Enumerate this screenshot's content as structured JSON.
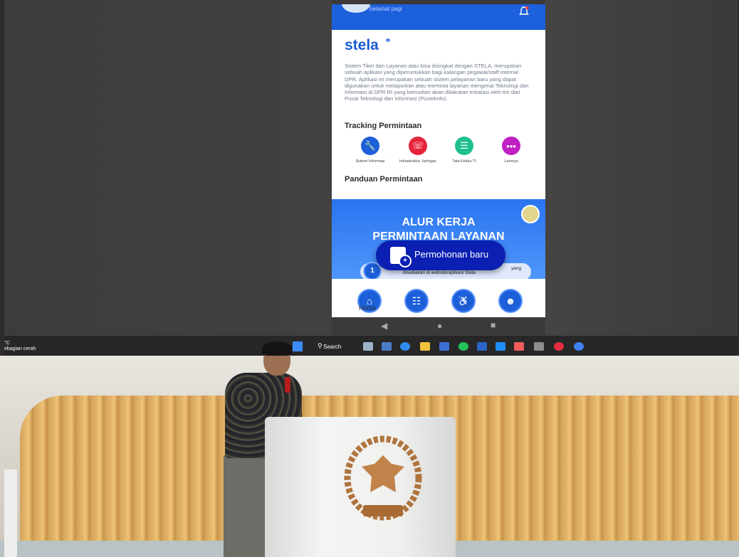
{
  "phone": {
    "greeting": "Selamat pagi",
    "app_name": "stela",
    "description": "Sistem Tiket dan Layanan atau bisa disingkat dengan STELA, merupakan sebuah aplikasi yang diperuntukkan bagi kalangan pegawai/staff internal DPR. Aplikasi ini merupakan sebuah sistem pelayanan baru yang dapat digunakan untuk melaporkan atau meminta layanan mengenai Teknologi dan Informasi di DPR RI yang kemudian akan dilakukan eskalasi oleh tim dari Pusat Teknologi dan Informasi (Pusteknfo).",
    "tracking_title": "Tracking Permintaan",
    "categories": [
      {
        "label": "Sistem Informasi",
        "icon": "wrench-icon",
        "color": "#1c5fd8"
      },
      {
        "label": "Infrastruktur Jaringan",
        "icon": "headset-icon",
        "color": "#e5243b"
      },
      {
        "label": "Tata Kelola TI",
        "icon": "document-icon",
        "color": "#1fbf8f"
      },
      {
        "label": "Lainnya",
        "icon": "more-icon",
        "color": "#c01fc4"
      }
    ],
    "guide_title": "Panduan Permintaan",
    "banner": {
      "title_line1": "ALUR KERJA",
      "title_line2": "PERMINTAAN LAYANAN",
      "step_number": "1",
      "step_text": "disediakan di website/aplikasi Stela",
      "step_text_end": "yang"
    },
    "fab_label": "Permohonan baru",
    "nav": {
      "home_label": "Home",
      "icons": [
        "home-icon",
        "document-list-icon",
        "accessibility-icon",
        "user-icon"
      ]
    }
  },
  "taskbar": {
    "weather_temp": "°C",
    "weather_text": "ebagian cerah",
    "search_label": "Search"
  },
  "colors": {
    "app_blue": "#1c60dc",
    "fab_blue": "#0b1fb3",
    "wood": "#e6b86a"
  }
}
